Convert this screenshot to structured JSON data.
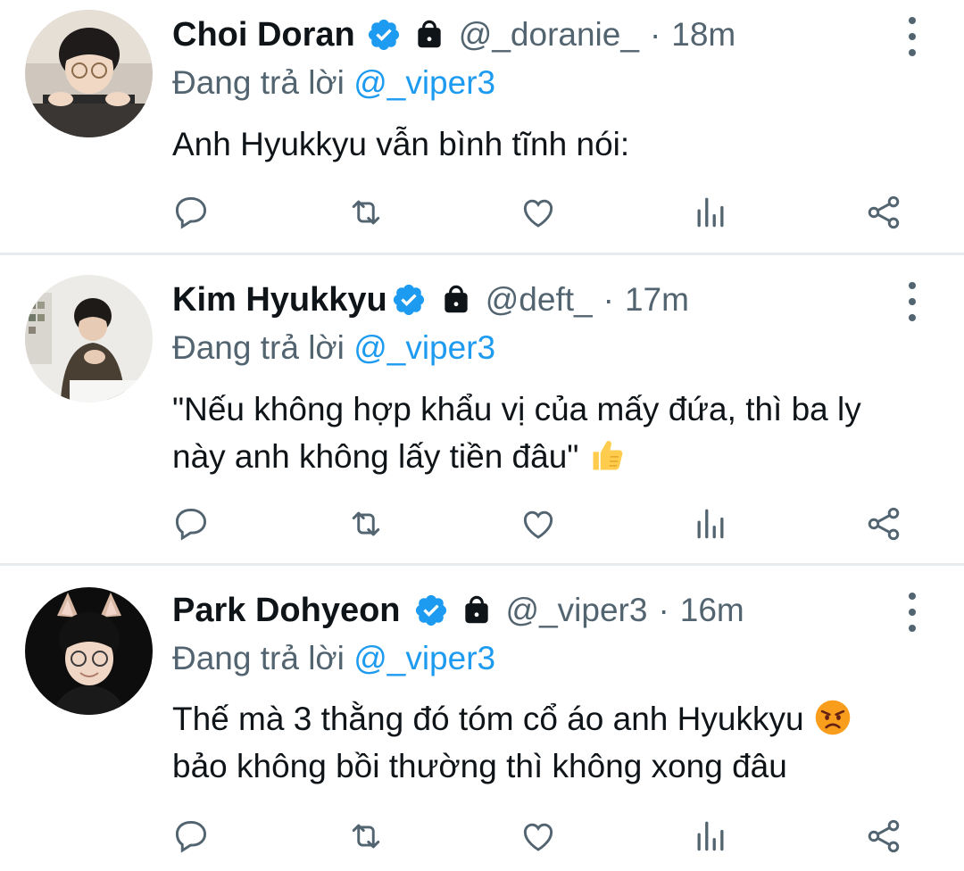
{
  "tweets": [
    {
      "name": "Choi Doran",
      "handle": "@_doranie_",
      "separator": "·",
      "time": "18m",
      "reply_prefix": "Đang trả lời ",
      "reply_mention": "@_viper3",
      "text_lines": [
        "Anh Hyukkyu vẫn bình tĩnh nói:"
      ]
    },
    {
      "name": "Kim Hyukkyu",
      "handle": "@deft_",
      "separator": "·",
      "time": "17m",
      "reply_prefix": "Đang trả lời ",
      "reply_mention": "@_viper3",
      "text_lines": [
        "\"Nếu không hợp khẩu vị của mấy đứa, thì ba ly",
        "này anh không lấy tiền đâu\""
      ],
      "emoji": "thumbs-up-emoji"
    },
    {
      "name": "Park Dohyeon",
      "handle": "@_viper3",
      "separator": "·",
      "time": "16m",
      "reply_prefix": "Đang trả lời ",
      "reply_mention": "@_viper3",
      "text_lines": [
        "Thế mà 3 thằng đó tóm cổ áo anh Hyukkyu",
        "bảo không bồi thường thì không xong đâu"
      ],
      "emoji": "angry-face-emoji"
    }
  ],
  "colors": {
    "accent": "#1d9bf0",
    "secondary_text": "#536471",
    "primary_text": "#0f1419",
    "divider": "#e8ecef"
  },
  "icons": [
    "reply-icon",
    "retweet-icon",
    "like-icon",
    "views-icon",
    "share-icon",
    "verified-badge-icon",
    "lock-icon",
    "more-options-icon"
  ]
}
